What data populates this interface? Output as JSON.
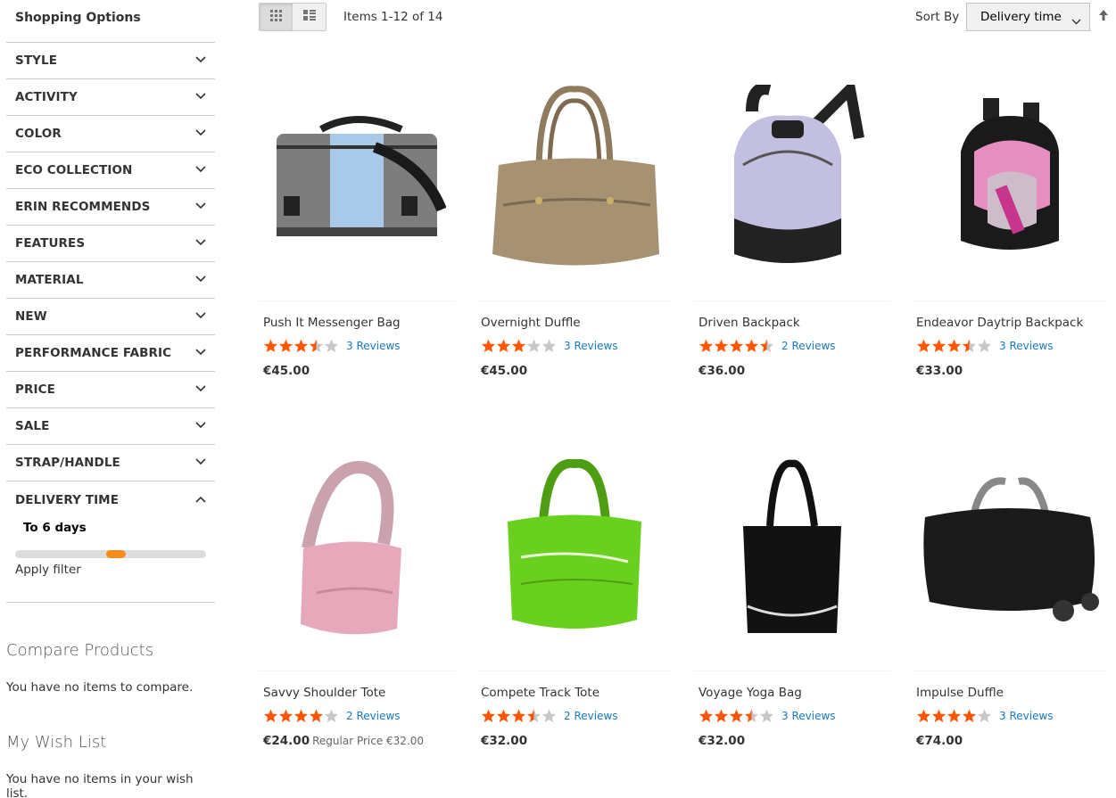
{
  "sidebar": {
    "title": "Shopping Options",
    "filters": [
      "STYLE",
      "ACTIVITY",
      "COLOR",
      "ECO COLLECTION",
      "ERIN RECOMMENDS",
      "FEATURES",
      "MATERIAL",
      "NEW",
      "PERFORMANCE FABRIC",
      "PRICE",
      "SALE",
      "STRAP/HANDLE"
    ],
    "delivery": {
      "label": "DELIVERY TIME",
      "value": "To 6 days",
      "slider_fraction": 0.53,
      "apply": "Apply filter"
    },
    "compare": {
      "title": "Compare Products",
      "text": "You have no items to compare."
    },
    "wishlist": {
      "title": "My Wish List",
      "text": "You have no items in your wish list."
    }
  },
  "toolbar": {
    "modes": [
      "grid-icon",
      "list-icon"
    ],
    "active_mode": "grid",
    "items_count": "Items 1-12 of 14",
    "sort_label": "Sort By",
    "sort_value": "Delivery time"
  },
  "colors": {
    "star": "#ff5501",
    "star_empty": "#c7c7c7",
    "link": "#1979c3",
    "slider": "#f78d1c"
  },
  "products": [
    {
      "name": "Push It Messenger Bag",
      "rating": 3.5,
      "reviews": "3 Reviews",
      "price": "€45.00",
      "image": "messenger-bag"
    },
    {
      "name": "Overnight Duffle",
      "rating": 3,
      "reviews": "3 Reviews",
      "price": "€45.00",
      "image": "duffle-tan"
    },
    {
      "name": "Driven Backpack",
      "rating": 4.5,
      "reviews": "2 Reviews",
      "price": "€36.00",
      "image": "backpack-lavender"
    },
    {
      "name": "Endeavor Daytrip Backpack",
      "rating": 3.5,
      "reviews": "3 Reviews",
      "price": "€33.00",
      "image": "backpack-pink"
    },
    {
      "name": "Savvy Shoulder Tote",
      "rating": 4,
      "reviews": "2 Reviews",
      "price": "€24.00",
      "old_price": "Regular Price €32.00",
      "image": "tote-pink"
    },
    {
      "name": "Compete Track Tote",
      "rating": 3.5,
      "reviews": "2 Reviews",
      "price": "€32.00",
      "image": "tote-green"
    },
    {
      "name": "Voyage Yoga Bag",
      "rating": 3.5,
      "reviews": "3 Reviews",
      "price": "€32.00",
      "image": "yoga-bag-black"
    },
    {
      "name": "Impulse Duffle",
      "rating": 4,
      "reviews": "3 Reviews",
      "price": "€74.00",
      "image": "duffle-rolling-black"
    }
  ]
}
